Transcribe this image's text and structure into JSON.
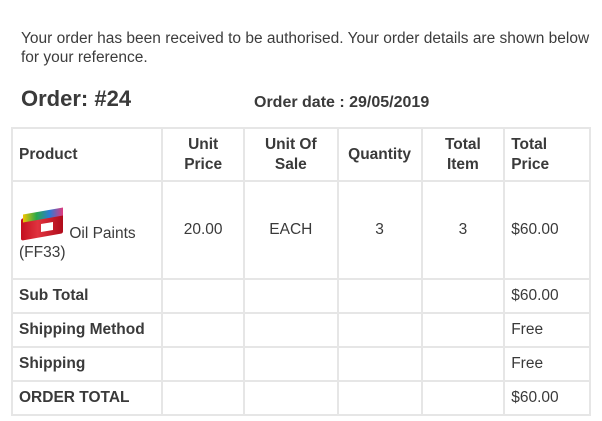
{
  "intro_text": "Your order has been received to be authorised. Your order details are shown below for your reference.",
  "order_title": "Order: #24",
  "order_date": "Order date : 29/05/2019",
  "table": {
    "headers": {
      "product": "Product",
      "unit_price": [
        "Unit",
        "Price"
      ],
      "unit_of_sale": [
        "Unit Of",
        "Sale"
      ],
      "quantity": "Quantity",
      "total_item": [
        "Total",
        "Item"
      ],
      "total_price": [
        "Total",
        "Price"
      ]
    },
    "product_row": {
      "image_icon": "oil-paints-box-icon",
      "name": "Oil Paints",
      "code": "(FF33)",
      "unit_price": "20.00",
      "unit_of_sale": "EACH",
      "quantity": "3",
      "total_item": "3",
      "total_price": "$60.00"
    },
    "summary": [
      {
        "label": "Sub Total",
        "value": "$60.00"
      },
      {
        "label": "Shipping Method",
        "value": "Free"
      },
      {
        "label": "Shipping",
        "value": "Free"
      },
      {
        "label": "ORDER TOTAL",
        "value": "$60.00"
      }
    ]
  }
}
